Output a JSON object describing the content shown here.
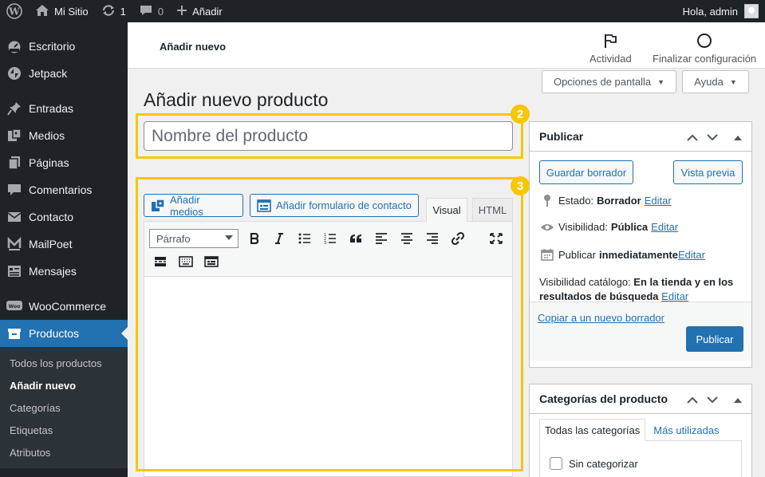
{
  "adminbar": {
    "site_name": "Mi Sitio",
    "updates_count": "1",
    "comments_count": "0",
    "add_new_label": "Añadir",
    "greeting": "Hola, admin"
  },
  "sidebar": {
    "items": [
      {
        "label": "Escritorio",
        "icon": "dashboard-icon"
      },
      {
        "label": "Jetpack",
        "icon": "jetpack-icon"
      },
      {
        "label": "Entradas",
        "icon": "pin-icon"
      },
      {
        "label": "Medios",
        "icon": "media-icon"
      },
      {
        "label": "Páginas",
        "icon": "pages-icon"
      },
      {
        "label": "Comentarios",
        "icon": "comment-icon"
      },
      {
        "label": "Contacto",
        "icon": "mail-icon"
      },
      {
        "label": "MailPoet",
        "icon": "mailpoet-icon"
      },
      {
        "label": "Mensajes",
        "icon": "messages-icon"
      },
      {
        "label": "WooCommerce",
        "icon": "woocommerce-icon"
      },
      {
        "label": "Productos",
        "icon": "products-icon"
      }
    ],
    "submenu": [
      "Todos los productos",
      "Añadir nuevo",
      "Categorías",
      "Etiquetas",
      "Atributos"
    ]
  },
  "header": {
    "title": "Añadir nuevo",
    "activity_label": "Actividad",
    "finish_setup_label": "Finalizar configuración"
  },
  "screen_options": {
    "options_label": "Opciones de pantalla",
    "help_label": "Ayuda"
  },
  "page": {
    "title": "Añadir nuevo producto",
    "title_placeholder": "Nombre del producto"
  },
  "callouts": {
    "title_box": "2",
    "editor_box": "3"
  },
  "editor": {
    "add_media_label": "Añadir medios",
    "add_form_label": "Añadir formulario de contacto",
    "tab_visual": "Visual",
    "tab_html": "HTML",
    "format_value": "Párrafo"
  },
  "publish": {
    "title": "Publicar",
    "save_draft_label": "Guardar borrador",
    "preview_label": "Vista previa",
    "status_label": "Estado:",
    "status_value": "Borrador",
    "visibility_label": "Visibilidad:",
    "visibility_value": "Pública",
    "publish_label": "Publicar",
    "publish_value": "inmediatamente",
    "catalog_label": "Visibilidad catálogo:",
    "catalog_value_1": "En la tienda y en los",
    "catalog_value_2": "resultados de búsqueda",
    "edit_label": "Editar",
    "copy_draft_label": "Copiar a un nuevo borrador",
    "publish_button_label": "Publicar"
  },
  "categories": {
    "title": "Categorías del producto",
    "tab_all": "Todas las categorías",
    "tab_popular": "Más utilizadas",
    "uncategorized_label": "Sin categorizar"
  },
  "colors": {
    "accent": "#2271b1",
    "highlight": "#f7c700",
    "sidebar_bg": "#1d2327"
  }
}
